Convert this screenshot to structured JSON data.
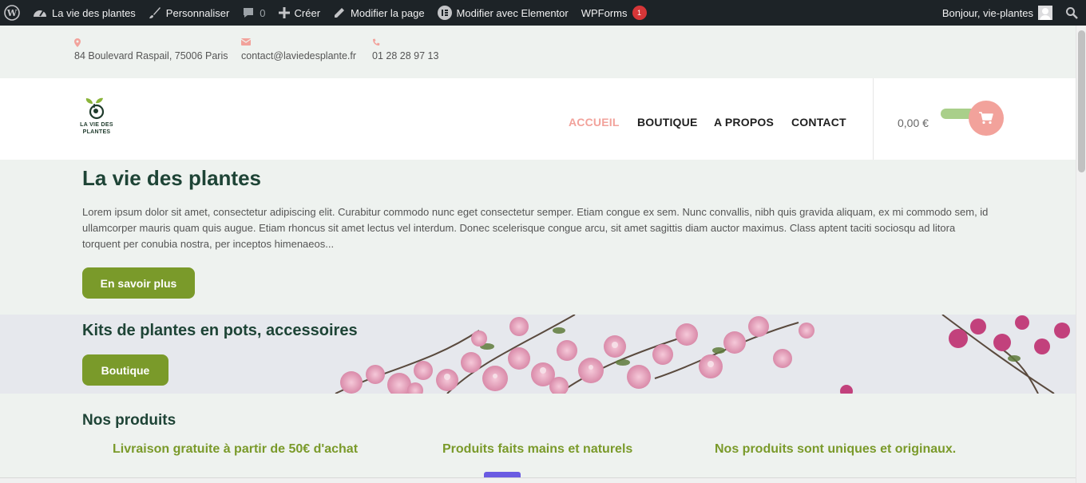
{
  "admin_bar": {
    "site_name": "La vie des plantes",
    "customize": "Personnaliser",
    "comments_count": "0",
    "new_label": "Créer",
    "edit_page": "Modifier la page",
    "edit_elementor": "Modifier avec Elementor",
    "wpforms": "WPForms",
    "wpforms_badge": "1",
    "greeting": "Bonjour, vie-plantes"
  },
  "top_info": {
    "address": "84 Boulevard Raspail, 75006 Paris",
    "email": "contact@laviedesplante.fr",
    "phone": "01 28 28 97 13"
  },
  "header": {
    "logo_text_1": "LA VIE DES",
    "logo_text_2": "PLANTES",
    "nav": [
      "ACCUEIL",
      "BOUTIQUE",
      "A PROPOS",
      "CONTACT"
    ],
    "cart_total": "0,00 €"
  },
  "hero": {
    "title": "La vie des plantes",
    "text": "Lorem ipsum dolor sit amet, consectetur adipiscing elit. Curabitur commodo nunc eget consectetur semper. Etiam congue ex sem. Nunc convallis, nibh quis gravida aliquam, ex mi commodo sem, id ullamcorper mauris quam quis augue. Etiam rhoncus sit amet lectus vel interdum. Donec scelerisque congue arcu, sit amet sagittis diam auctor maximus. Class aptent taciti sociosqu ad litora torquent per conubia nostra, per inceptos himenaeos...",
    "button": "En savoir plus"
  },
  "banner": {
    "title": "Kits de plantes en pots, accessoires",
    "button": "Boutique"
  },
  "products": {
    "title": "Nos produits",
    "features": [
      "Livraison gratuite à partir de 50€ d'achat",
      "Produits faits mains et naturels",
      "Nos produits sont uniques et originaux."
    ]
  },
  "colors": {
    "accent_pink": "#f2a29b",
    "brand_green": "#7a9a2a",
    "heading_green": "#1e4436",
    "admin_bar": "#1d2327"
  }
}
